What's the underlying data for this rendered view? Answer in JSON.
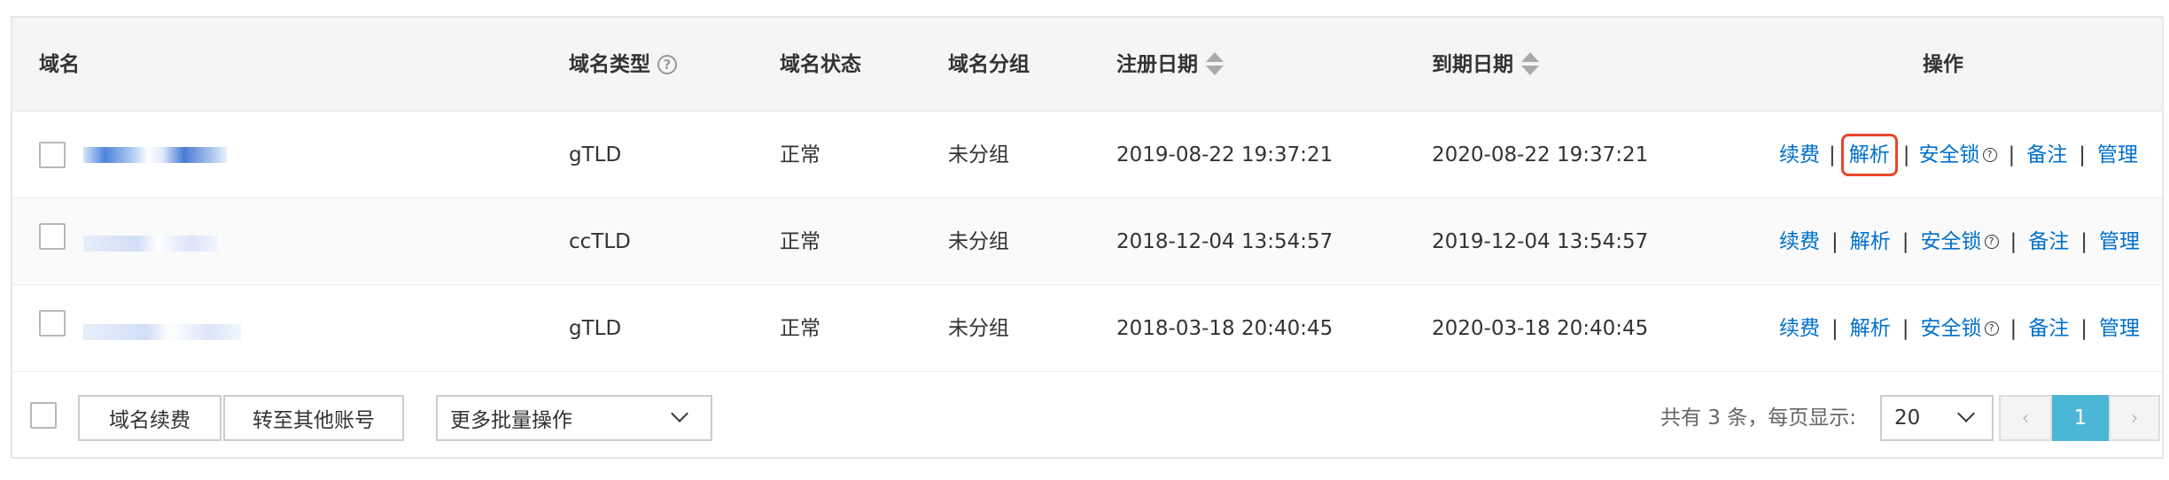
{
  "table": {
    "columns": {
      "domain": "域名",
      "type": "域名类型",
      "status": "域名状态",
      "group": "域名分组",
      "reg_date": "注册日期",
      "exp_date": "到期日期",
      "actions": "操作"
    },
    "help_glyph": "?",
    "rows": [
      {
        "type": "gTLD",
        "status": "正常",
        "group": "未分组",
        "reg_date": "2019-08-22 19:37:21",
        "exp_date": "2020-08-22 19:37:21"
      },
      {
        "type": "ccTLD",
        "status": "正常",
        "group": "未分组",
        "reg_date": "2018-12-04 13:54:57",
        "exp_date": "2019-12-04 13:54:57"
      },
      {
        "type": "gTLD",
        "status": "正常",
        "group": "未分组",
        "reg_date": "2018-03-18 20:40:45",
        "exp_date": "2020-03-18 20:40:45"
      }
    ],
    "actions": {
      "renew": "续费",
      "dns": "解析",
      "lock": "安全锁",
      "note": "备注",
      "manage": "管理",
      "separator": "|"
    },
    "highlighted_action": "解析"
  },
  "footer": {
    "renew_button": "域名续费",
    "transfer_button": "转至其他账号",
    "batch_select": "更多批量操作",
    "total_text": "共有 3 条，每页显示:",
    "page_size": "20",
    "prev": "‹",
    "current_page": "1",
    "next": "›"
  },
  "colors": {
    "link": "#0070cc",
    "highlight_border": "#e8472b",
    "pager_active": "#4cb6d6",
    "header_bg": "#f5f5f6"
  }
}
